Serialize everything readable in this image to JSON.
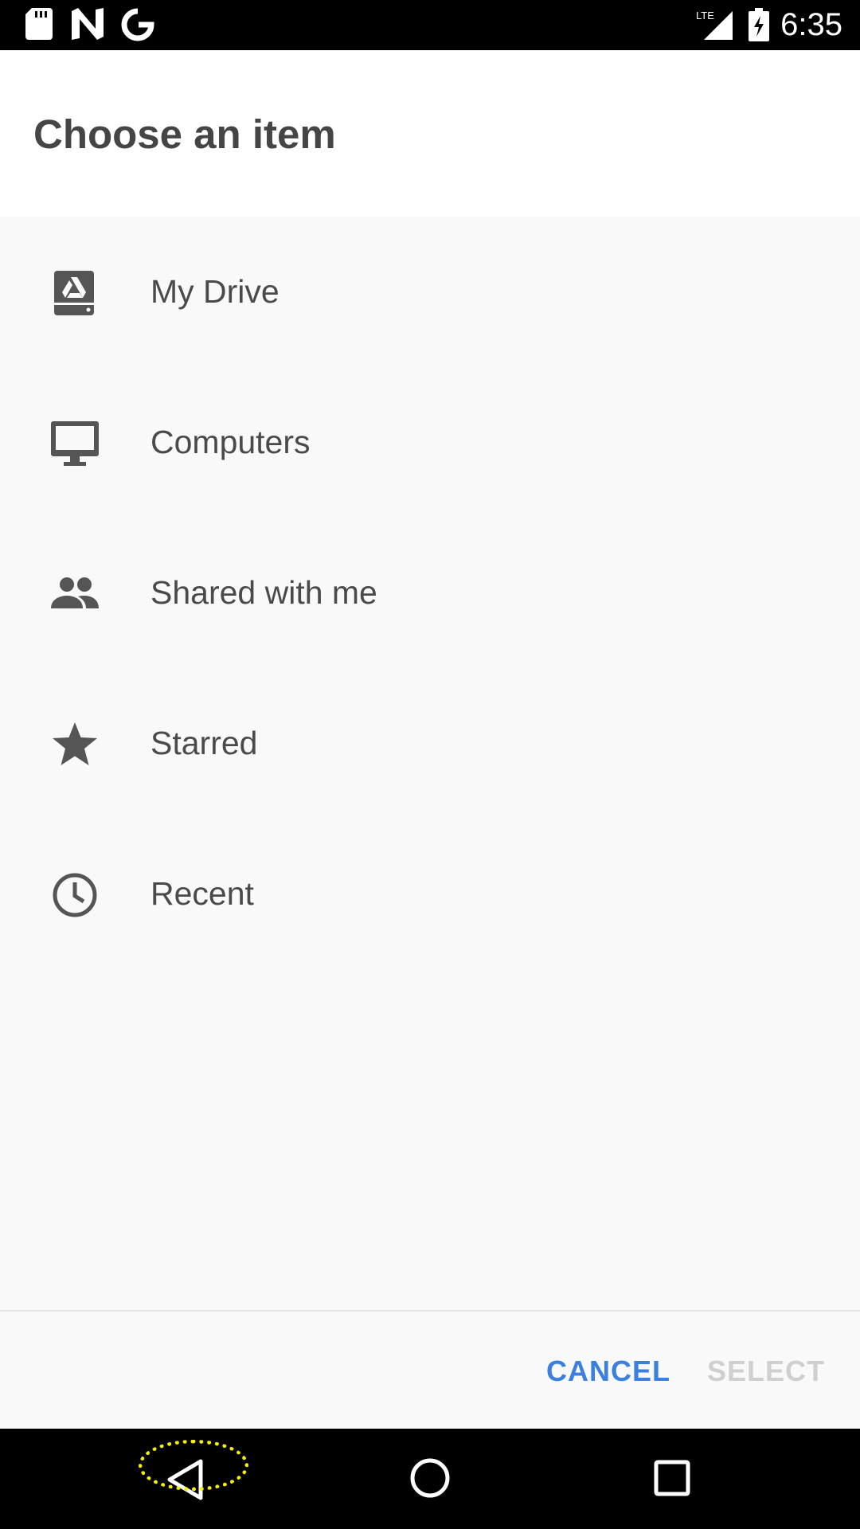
{
  "status_bar": {
    "time": "6:35",
    "network": "LTE",
    "icons": [
      "sd-card-icon",
      "n-notification-icon",
      "google-icon",
      "signal-icon",
      "battery-charging-icon"
    ]
  },
  "dialog": {
    "title": "Choose an item",
    "items": [
      {
        "label": "My Drive",
        "icon": "drive-icon"
      },
      {
        "label": "Computers",
        "icon": "computer-icon"
      },
      {
        "label": "Shared with me",
        "icon": "people-icon"
      },
      {
        "label": "Starred",
        "icon": "star-icon"
      },
      {
        "label": "Recent",
        "icon": "clock-icon"
      }
    ],
    "cancel_label": "CANCEL",
    "select_label": "SELECT"
  },
  "nav_bar": {
    "icons": [
      "back-icon",
      "home-icon",
      "recents-icon"
    ],
    "highlight_color": "#f5f000"
  },
  "colors": {
    "accent": "#3b80df",
    "disabled": "#cfcfcf",
    "text": "#4a4a4a",
    "icon": "#555555"
  }
}
